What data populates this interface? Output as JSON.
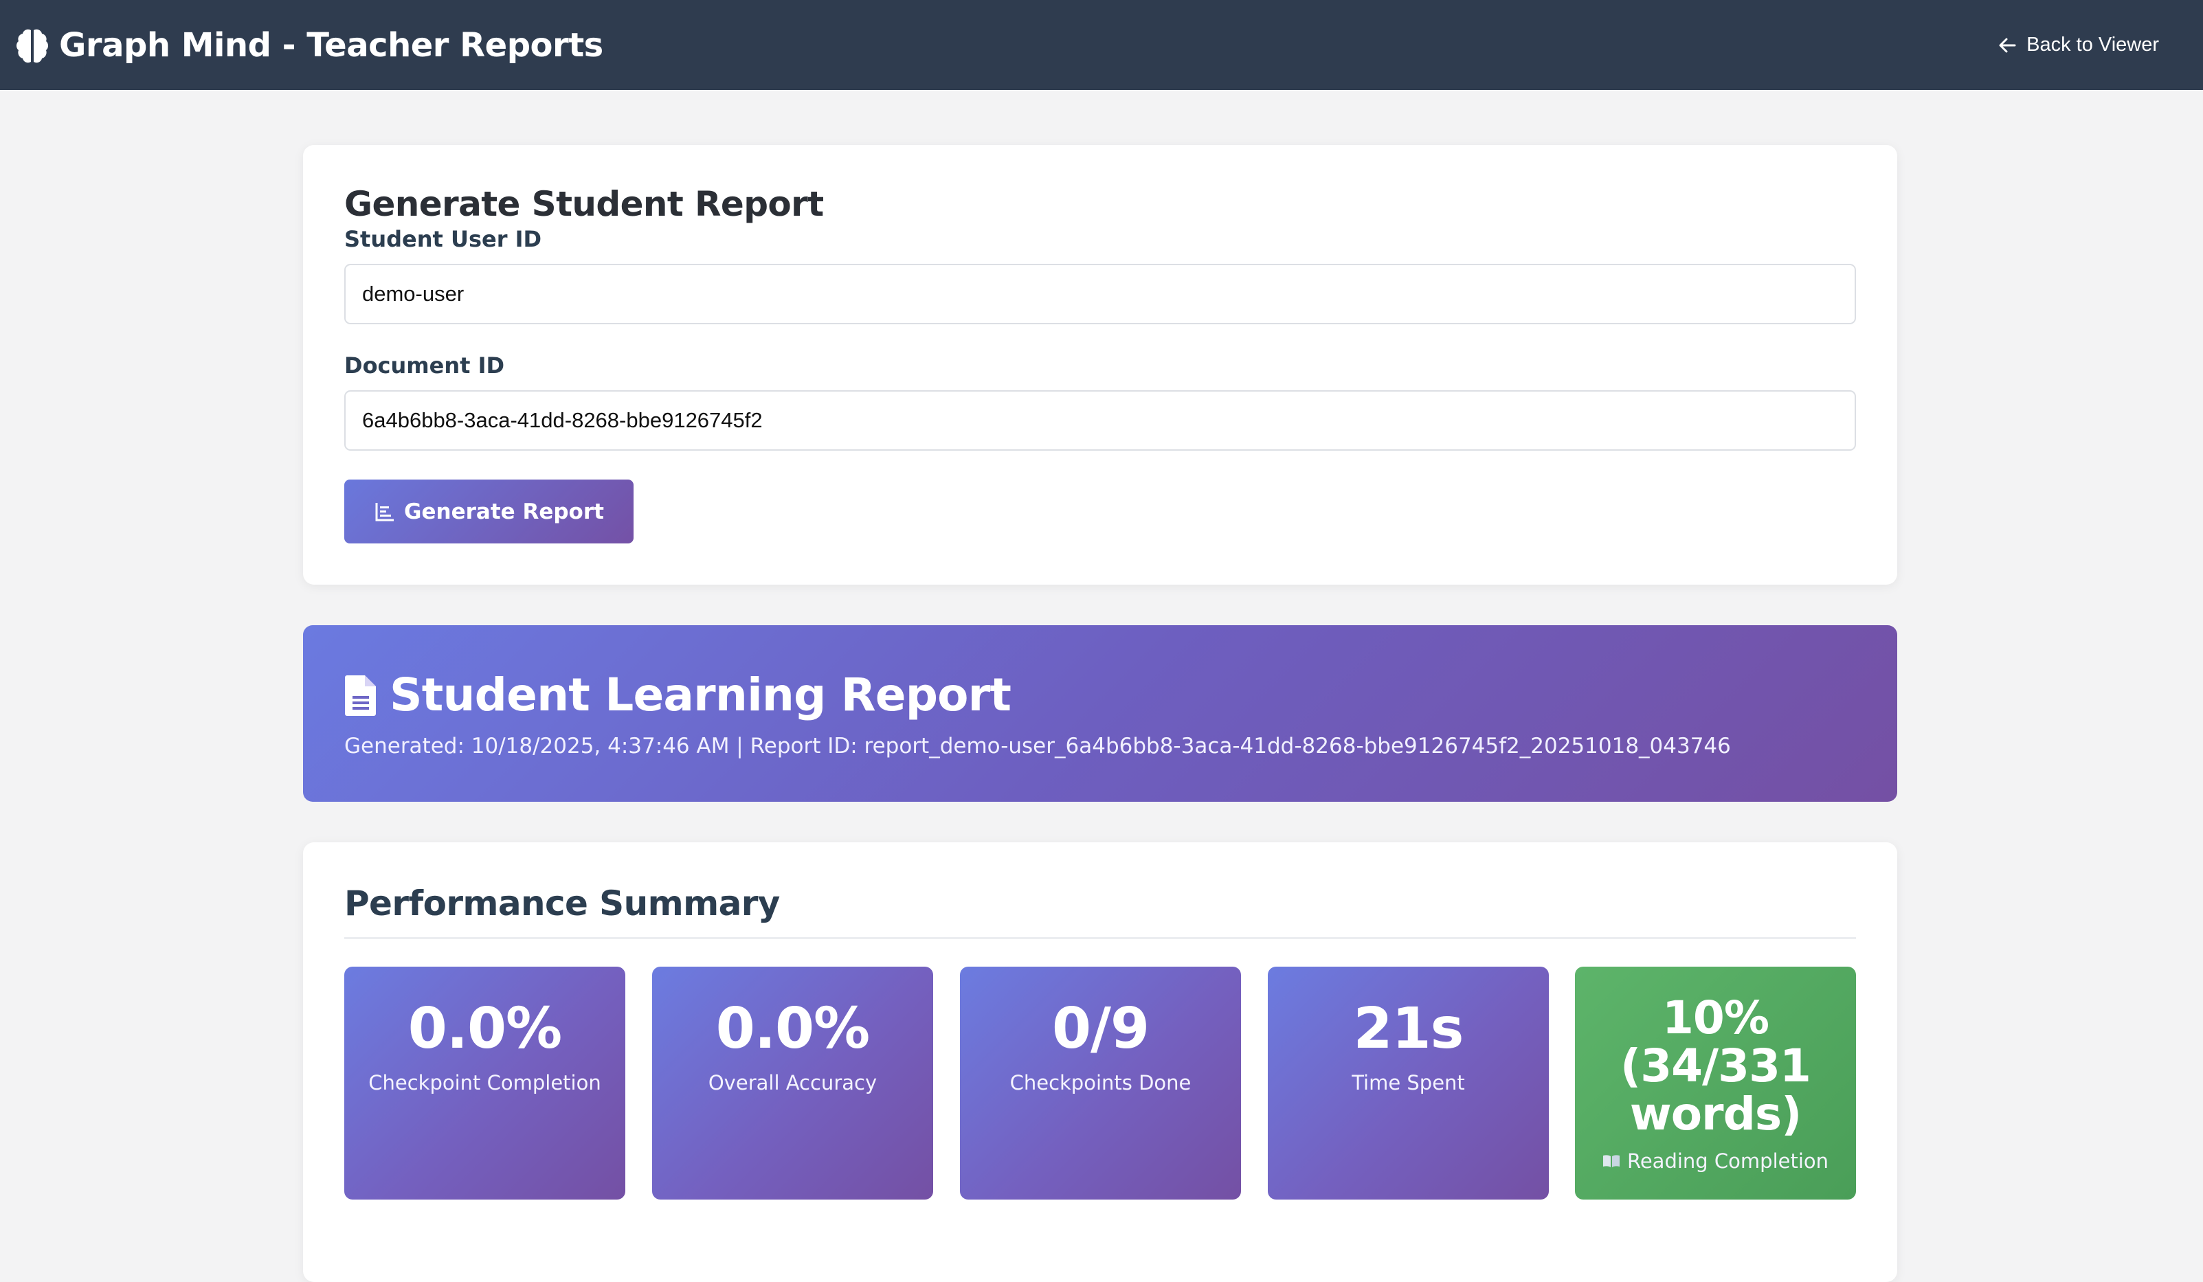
{
  "header": {
    "title": "Graph Mind - Teacher Reports",
    "back_label": "Back to Viewer"
  },
  "form": {
    "title": "Generate Student Report",
    "user_id_label": "Student User ID",
    "user_id_value": "demo-user",
    "document_id_label": "Document ID",
    "document_id_value": "6a4b6bb8-3aca-41dd-8268-bbe9126745f2",
    "generate_label": "Generate Report"
  },
  "report": {
    "title": "Student Learning Report",
    "meta": "Generated: 10/18/2025, 4:37:46 AM | Report ID: report_demo-user_6a4b6bb8-3aca-41dd-8268-bbe9126745f2_20251018_043746"
  },
  "summary": {
    "title": "Performance Summary",
    "stats": [
      {
        "value": "0.0%",
        "label": "Checkpoint Completion"
      },
      {
        "value": "0.0%",
        "label": "Overall Accuracy"
      },
      {
        "value": "0/9",
        "label": "Checkpoints Done"
      },
      {
        "value": "21s",
        "label": "Time Spent"
      },
      {
        "value": "10% (34/331 words)",
        "label": "Reading Completion",
        "icon": "book-icon"
      }
    ]
  },
  "colors": {
    "topbar": "#2f3c4f",
    "accent_start": "#6a78dc",
    "accent_end": "#7451a6",
    "success": "#4f9f5b"
  }
}
